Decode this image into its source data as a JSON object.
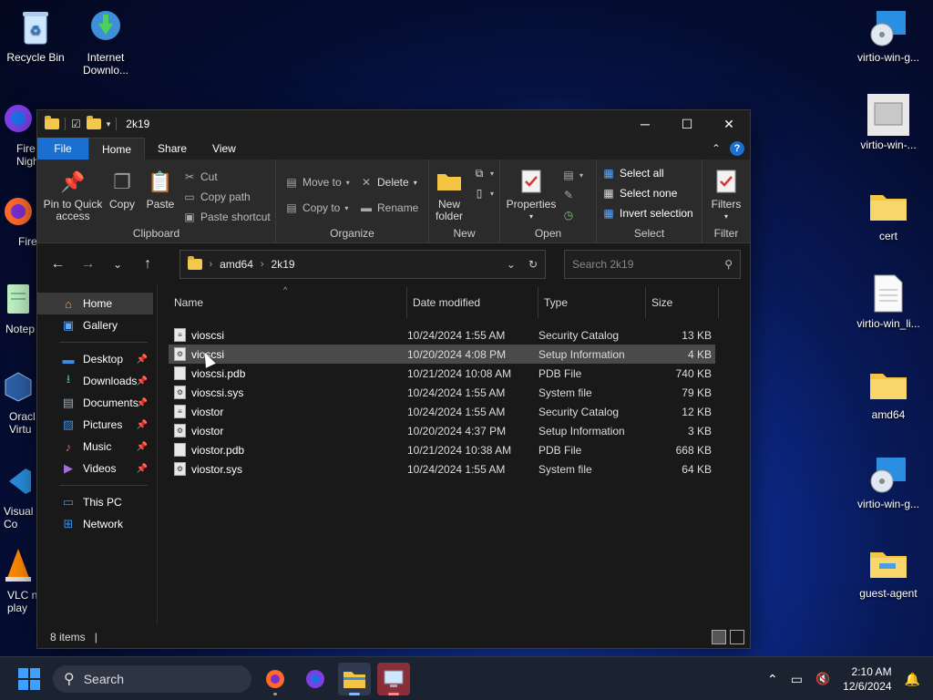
{
  "desktop": {
    "left_icons": [
      {
        "label": "Recycle Bin",
        "icon": "recycle-bin-icon"
      },
      {
        "label": "Internet Downlo...",
        "icon": "download-manager-icon"
      },
      {
        "label": "Fire Nigh",
        "icon": "firefox-nightly-icon"
      },
      {
        "label": "Fire",
        "icon": "firefox-icon"
      },
      {
        "label": "Notep",
        "icon": "notepad-icon"
      },
      {
        "label": "Oracl Virtu",
        "icon": "virtualbox-icon"
      },
      {
        "label": "Visual Co",
        "icon": "vscode-icon"
      },
      {
        "label": "VLC n play",
        "icon": "vlc-icon"
      }
    ],
    "right_icons": [
      {
        "label": "virtio-win-g...",
        "icon": "disc-installer-icon"
      },
      {
        "label": "virtio-win-...",
        "icon": "installer-icon"
      },
      {
        "label": "cert",
        "icon": "folder-icon"
      },
      {
        "label": "virtio-win_li...",
        "icon": "document-icon"
      },
      {
        "label": "amd64",
        "icon": "folder-icon"
      },
      {
        "label": "virtio-win-g...",
        "icon": "disc-installer-icon"
      },
      {
        "label": "guest-agent",
        "icon": "folder-icon"
      }
    ]
  },
  "window": {
    "title": "2k19",
    "controls": {
      "minimize": "─",
      "maximize": "☐",
      "close": "✕"
    },
    "ribbon_tabs": [
      "File",
      "Home",
      "Share",
      "View"
    ],
    "ribbon": {
      "clipboard": {
        "name": "Clipboard",
        "pin": "Pin to Quick access",
        "copy": "Copy",
        "paste": "Paste",
        "cut": "Cut",
        "copy_path": "Copy path",
        "paste_shortcut": "Paste shortcut"
      },
      "organize": {
        "name": "Organize",
        "move_to": "Move to",
        "copy_to": "Copy to",
        "delete": "Delete",
        "rename": "Rename"
      },
      "new": {
        "name": "New",
        "new_folder": "New folder"
      },
      "open": {
        "name": "Open",
        "properties": "Properties"
      },
      "select": {
        "name": "Select",
        "select_all": "Select all",
        "select_none": "Select none",
        "invert": "Invert selection"
      },
      "filter": {
        "name": "Filter",
        "filters": "Filters"
      }
    },
    "address": {
      "path": [
        "amd64",
        "2k19"
      ]
    },
    "search": {
      "placeholder": "Search 2k19"
    },
    "nav_pane": {
      "quick": [
        {
          "label": "Home",
          "icon": "home-icon",
          "selected": true
        },
        {
          "label": "Gallery",
          "icon": "gallery-icon"
        }
      ],
      "pinned": [
        {
          "label": "Desktop",
          "icon": "desktop-folder-icon"
        },
        {
          "label": "Downloads",
          "icon": "downloads-icon"
        },
        {
          "label": "Documents",
          "icon": "documents-icon"
        },
        {
          "label": "Pictures",
          "icon": "pictures-icon"
        },
        {
          "label": "Music",
          "icon": "music-icon"
        },
        {
          "label": "Videos",
          "icon": "videos-icon"
        }
      ],
      "locations": [
        {
          "label": "This PC",
          "icon": "pc-icon"
        },
        {
          "label": "Network",
          "icon": "network-icon"
        }
      ]
    },
    "columns": [
      "Name",
      "Date modified",
      "Type",
      "Size"
    ],
    "files": [
      {
        "name": "vioscsi",
        "date": "10/24/2024 1:55 AM",
        "type": "Security Catalog",
        "size": "13 KB",
        "icon": "catalog-file-icon"
      },
      {
        "name": "vioscsi",
        "date": "10/20/2024 4:08 PM",
        "type": "Setup Information",
        "size": "4 KB",
        "icon": "setup-info-file-icon"
      },
      {
        "name": "vioscsi.pdb",
        "date": "10/21/2024 10:08 AM",
        "type": "PDB File",
        "size": "740 KB",
        "icon": "blank-file-icon"
      },
      {
        "name": "vioscsi.sys",
        "date": "10/24/2024 1:55 AM",
        "type": "System file",
        "size": "79 KB",
        "icon": "system-file-icon"
      },
      {
        "name": "viostor",
        "date": "10/24/2024 1:55 AM",
        "type": "Security Catalog",
        "size": "12 KB",
        "icon": "catalog-file-icon"
      },
      {
        "name": "viostor",
        "date": "10/20/2024 4:37 PM",
        "type": "Setup Information",
        "size": "3 KB",
        "icon": "setup-info-file-icon"
      },
      {
        "name": "viostor.pdb",
        "date": "10/21/2024 10:38 AM",
        "type": "PDB File",
        "size": "668 KB",
        "icon": "blank-file-icon"
      },
      {
        "name": "viostor.sys",
        "date": "10/24/2024 1:55 AM",
        "type": "System file",
        "size": "64 KB",
        "icon": "system-file-icon"
      }
    ],
    "status": {
      "item_count": "8 items"
    }
  },
  "taskbar": {
    "search_label": "Search",
    "apps": [
      "firefox-icon",
      "firefox-nightly-icon",
      "file-explorer-icon",
      "remote-desktop-icon"
    ],
    "clock": {
      "time": "2:10 AM",
      "date": "12/6/2024"
    }
  },
  "colors": {
    "accent": "#1a6fd1",
    "folder": "#f2c94c",
    "window_bg": "#191919",
    "ribbon_bg": "#2b2b2b"
  }
}
